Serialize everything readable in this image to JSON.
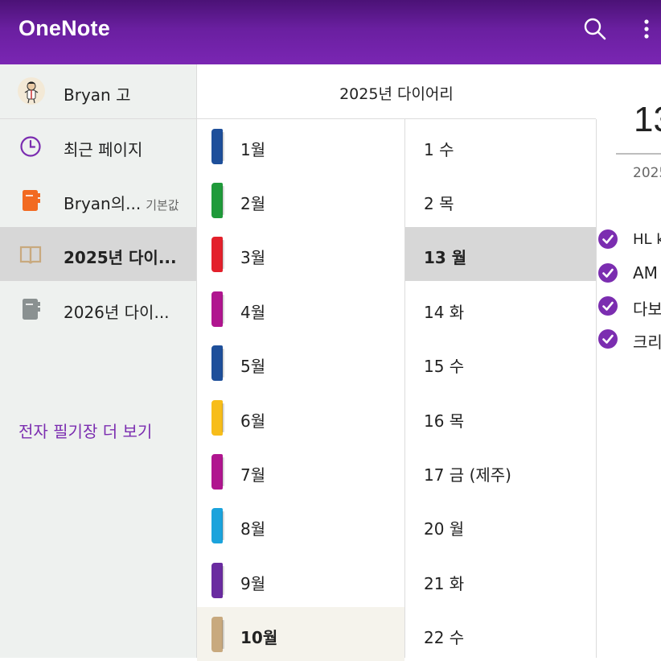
{
  "app": {
    "title": "OneNote"
  },
  "colors": {
    "accent": "#7b2db0",
    "appbar": "#6a1fa0"
  },
  "toolbar": {
    "search_icon": "search-icon",
    "more_icon": "more-vertical-icon"
  },
  "nav": {
    "user_name": "Bryan 고",
    "items": [
      {
        "label": "최근 페이지",
        "icon": "clock-icon"
      },
      {
        "label": "Bryan의...",
        "tag": "기본값",
        "icon": "notebook-icon",
        "color": "#f26a21"
      },
      {
        "label": "2025년 다이...",
        "icon": "open-book-icon",
        "color": "#c8a97e"
      },
      {
        "label": "2026년 다이...",
        "icon": "notebook-icon",
        "color": "#8a9191"
      }
    ],
    "more_notebooks": "전자 필기장 더 보기"
  },
  "sections": {
    "header": "2025년 다이어리",
    "items": [
      {
        "label": "1월",
        "color": "#1e4f9a"
      },
      {
        "label": "2월",
        "color": "#1f9a3a"
      },
      {
        "label": "3월",
        "color": "#e3202b"
      },
      {
        "label": "4월",
        "color": "#b0158f"
      },
      {
        "label": "5월",
        "color": "#1e4f9a"
      },
      {
        "label": "6월",
        "color": "#f7bd1a"
      },
      {
        "label": "7월",
        "color": "#b0158f"
      },
      {
        "label": "8월",
        "color": "#1ba3dc"
      },
      {
        "label": "9월",
        "color": "#6a2ba0"
      },
      {
        "label": "10월",
        "color": "#c8a97e"
      }
    ]
  },
  "pages": {
    "items": [
      {
        "label": "1 수"
      },
      {
        "label": "2 목"
      },
      {
        "label": "13 월"
      },
      {
        "label": "14 화"
      },
      {
        "label": "15 수"
      },
      {
        "label": "16 목"
      },
      {
        "label": "17 금 (제주)"
      },
      {
        "label": "20 월"
      },
      {
        "label": "21 화"
      },
      {
        "label": "22 수"
      }
    ]
  },
  "content": {
    "title": "13",
    "date": "2025",
    "todos": [
      {
        "text": "HL k"
      },
      {
        "text": "AM"
      },
      {
        "text": "다보"
      },
      {
        "text": "크리"
      }
    ]
  }
}
